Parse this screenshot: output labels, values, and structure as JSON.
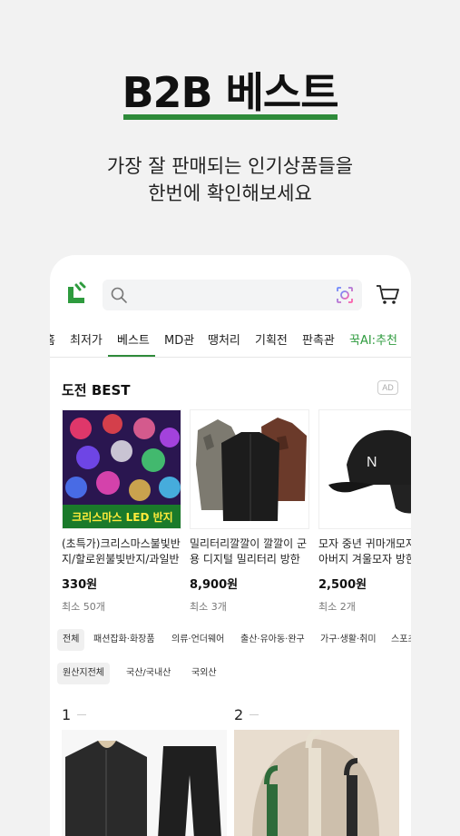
{
  "hero": {
    "title": "B2B 베스트",
    "subtitle_line1": "가장 잘 판매되는 인기상품들을",
    "subtitle_line2": "한번에 확인해보세요"
  },
  "colors": {
    "brand_green": "#2e8b3a",
    "background": "#f2f2f2"
  },
  "app": {
    "tabs": [
      {
        "label": "홈"
      },
      {
        "label": "최저가"
      },
      {
        "label": "베스트",
        "active": true
      },
      {
        "label": "MD관"
      },
      {
        "label": "땡처리"
      },
      {
        "label": "기획전"
      },
      {
        "label": "판촉관"
      },
      {
        "label": "꾹AI:추천"
      }
    ],
    "section_title": "도전 BEST",
    "ad_label": "AD",
    "products": [
      {
        "image_text": "크리스마스 LED 반지",
        "name": "(초특가)크리스마스불빛반지/할로윈불빛반지/과일반지",
        "price": "330원",
        "min_order": "최소 50개"
      },
      {
        "name": "밀리터리깔깔이 깔깔이 군용 디지털 밀리터리 방한복",
        "price": "8,900원",
        "min_order": "최소 3개"
      },
      {
        "name": "모자 중년 귀마개모자 할아버지 겨울모자 방한모자",
        "price": "2,500원",
        "min_order": "최소 2개"
      }
    ],
    "category_chips": [
      {
        "label": "전체",
        "active": true
      },
      {
        "label": "패션잡화·화장품"
      },
      {
        "label": "의류·언더웨어"
      },
      {
        "label": "출산·유아동·완구"
      },
      {
        "label": "가구·생활·취미"
      },
      {
        "label": "스포츠"
      }
    ],
    "origin_chips": [
      {
        "label": "원산지전체",
        "active": true
      },
      {
        "label": "국산/국내산"
      },
      {
        "label": "국외산"
      }
    ],
    "ranks": [
      {
        "num": "1"
      },
      {
        "num": "2"
      }
    ]
  }
}
